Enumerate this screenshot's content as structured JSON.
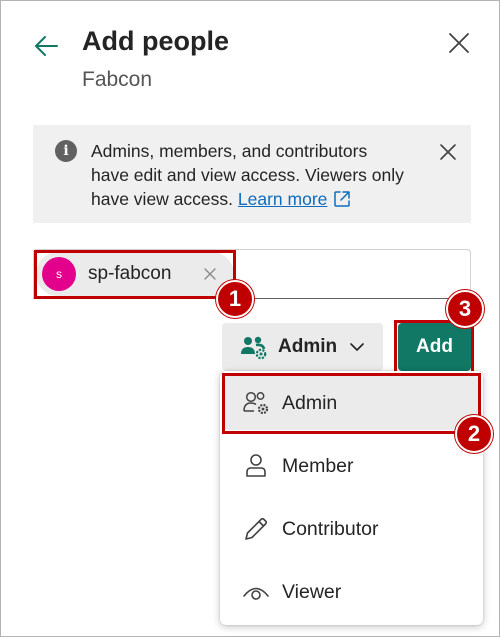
{
  "header": {
    "title": "Add people",
    "subtitle": "Fabcon",
    "back_icon": "arrow-left-icon",
    "close_icon": "close-icon"
  },
  "info_bar": {
    "icon": "info-icon",
    "icon_glyph": "i",
    "line1": "Admins, members, and contributors",
    "line2": "have edit and view access. Viewers only",
    "line3": "have view access.",
    "learn_more": "Learn more",
    "learn_more_icon": "open-external-icon",
    "dismiss_icon": "close-icon"
  },
  "people_picker": {
    "chips": [
      {
        "initial": "s",
        "name": "sp-fabcon",
        "avatar_color": "#e3008c",
        "remove_icon": "dismiss-icon"
      }
    ]
  },
  "role_dropdown": {
    "selected": "Admin",
    "icon": "people-settings-icon",
    "chevron": "chevron-down-icon"
  },
  "add_button": {
    "label": "Add",
    "color": "#117865"
  },
  "menu": {
    "items": [
      {
        "label": "Admin",
        "icon": "people-settings-icon",
        "selected": true
      },
      {
        "label": "Member",
        "icon": "person-icon",
        "selected": false
      },
      {
        "label": "Contributor",
        "icon": "pencil-icon",
        "selected": false
      },
      {
        "label": "Viewer",
        "icon": "eye-icon",
        "selected": false
      }
    ]
  },
  "annotations": {
    "callout_color": "#c00000",
    "steps": [
      "1",
      "2",
      "3"
    ]
  }
}
